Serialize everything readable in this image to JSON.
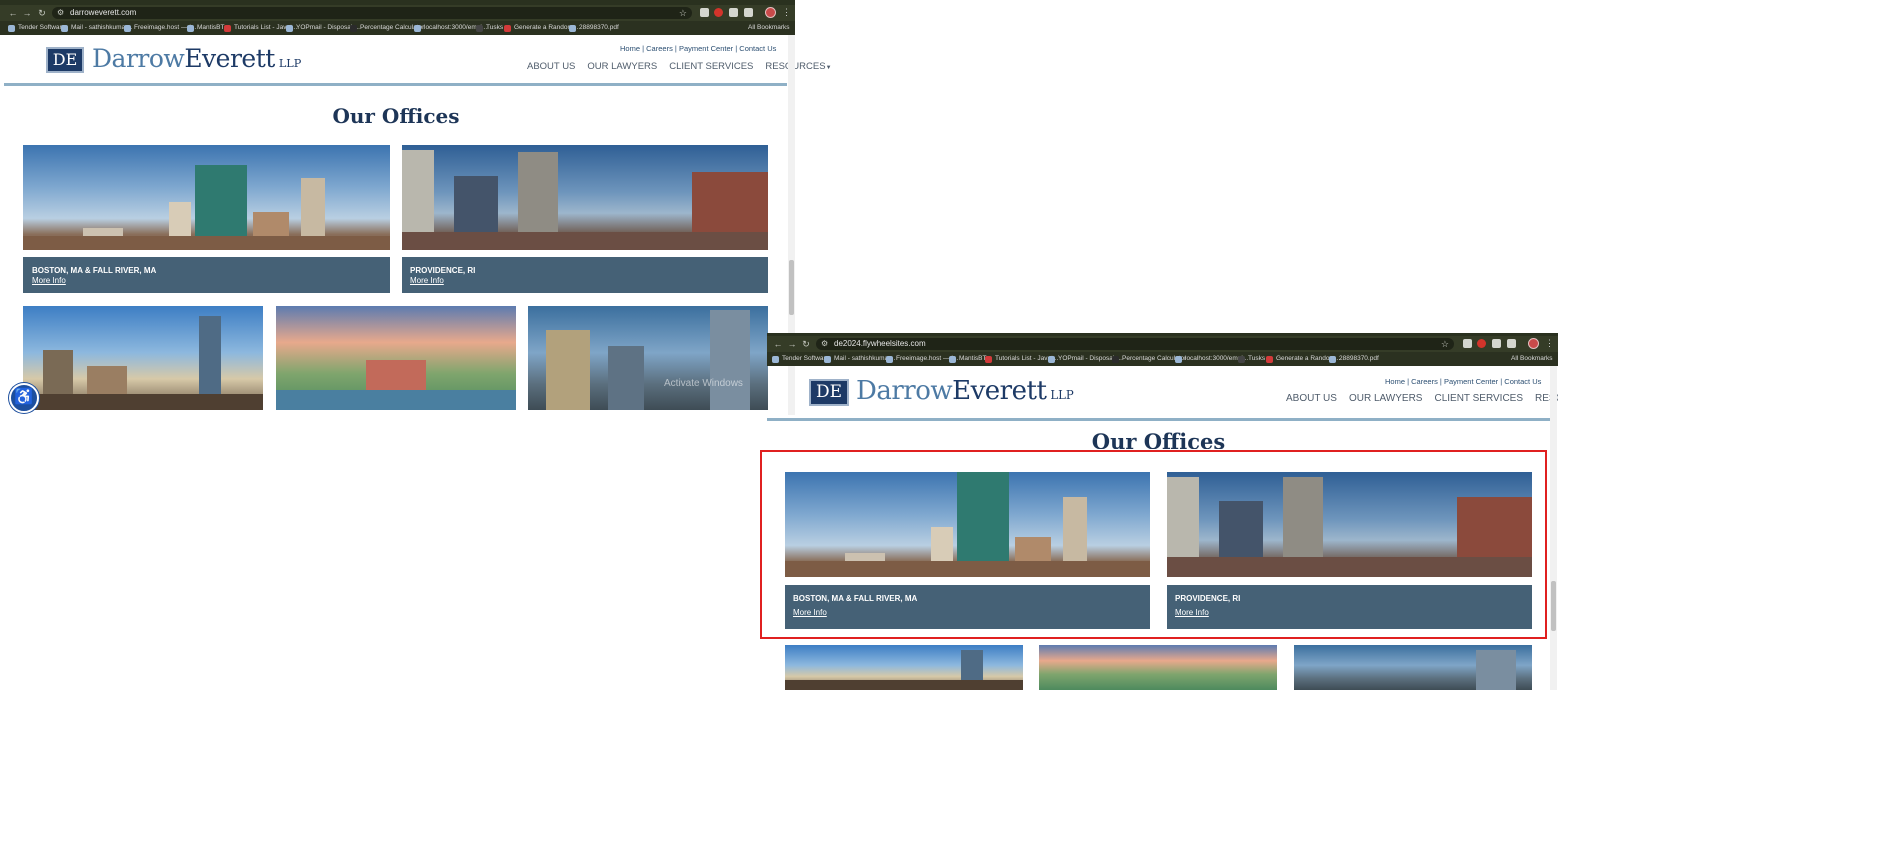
{
  "window1": {
    "url": "darroweverett.com",
    "bookmarks": [
      "Tender Software",
      "Mail - sathishkumar...",
      "Freeimage.host — I...",
      "MantisBT",
      "Tutorials List - Javat...",
      "YOPmail - Disposab...",
      "Percentage Calculator",
      "localhost:3000/empl...",
      "Tusks",
      "Generate a Random...",
      "28898370.pdf"
    ],
    "all_bookmarks": "All Bookmarks"
  },
  "window2": {
    "url": "de2024.flywheelsites.com",
    "bookmarks": [
      "Tender Software",
      "Mail - sathishkumar...",
      "Freeimage.host — I...",
      "MantisBT",
      "Tutorials List - Javat...",
      "YOPmail - Disposab...",
      "Percentage Calculator",
      "localhost:3000/empl...",
      "Tusks",
      "Generate a Random...",
      "28898370.pdf"
    ],
    "all_bookmarks": "All Bookmarks"
  },
  "site": {
    "logo_monogram": "DE",
    "logo_darrow": "Darrow",
    "logo_everett": "Everett",
    "logo_llp": "LLP",
    "utility_links": [
      "Home",
      "Careers",
      "Payment Center",
      "Contact Us"
    ],
    "nav": [
      "ABOUT US",
      "OUR LAWYERS",
      "CLIENT SERVICES",
      "RESOURCES"
    ],
    "heading": "Our Offices",
    "offices": [
      {
        "city": "BOSTON, MA & FALL RIVER, MA",
        "link": "More Info"
      },
      {
        "city": "PROVIDENCE, RI",
        "link": "More Info"
      }
    ],
    "watermark": "Activate Windows"
  },
  "colors": {
    "navy": "#1d3557",
    "card": "#456176",
    "highlight": "#e02020"
  },
  "icons": [
    "back-icon",
    "forward-icon",
    "reload-icon",
    "star-icon",
    "accessibility-icon",
    "kebab-menu-icon",
    "dropdown-caret-icon"
  ]
}
